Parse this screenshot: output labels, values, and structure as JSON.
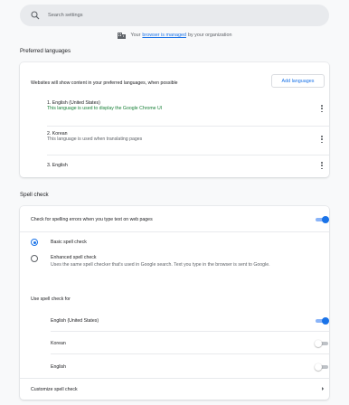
{
  "search": {
    "placeholder": "Search settings"
  },
  "managed_notice": {
    "prefix": "Your",
    "link": "browser is managed",
    "suffix": "by your organization"
  },
  "preferred_languages": {
    "title": "Preferred languages",
    "description": "Websites will show content in your preferred languages, when possible",
    "add_button": "Add languages",
    "languages": [
      {
        "name": "1. English (United States)",
        "note": "This language is used to display the Google Chrome UI"
      },
      {
        "name": "2. Korean",
        "note": "This language is used when translating pages"
      },
      {
        "name": "3. English",
        "note": ""
      }
    ]
  },
  "spell_check": {
    "title": "Spell check",
    "check_label": "Check for spelling errors when you type text on web pages",
    "check_enabled": true,
    "basic_label": "Basic spell check",
    "basic_selected": true,
    "enhanced_label": "Enhanced spell check",
    "enhanced_desc": "Uses the same spell checker that's used in Google search. Text you type in the browser is sent to Google.",
    "enhanced_selected": false,
    "use_for_label": "Use spell check for",
    "use_for": [
      {
        "name": "English (United States)",
        "enabled": true
      },
      {
        "name": "Korean",
        "enabled": false
      },
      {
        "name": "English",
        "enabled": false
      }
    ],
    "customize_label": "Customize spell check"
  },
  "colors": {
    "accent": "#1a73e8",
    "green_note": "#188038",
    "background": "#f8f9fa"
  },
  "icons": {
    "search": "search-icon",
    "managed": "building-icon",
    "menu": "more-vert-icon",
    "chevron": "chevron-right-icon"
  }
}
